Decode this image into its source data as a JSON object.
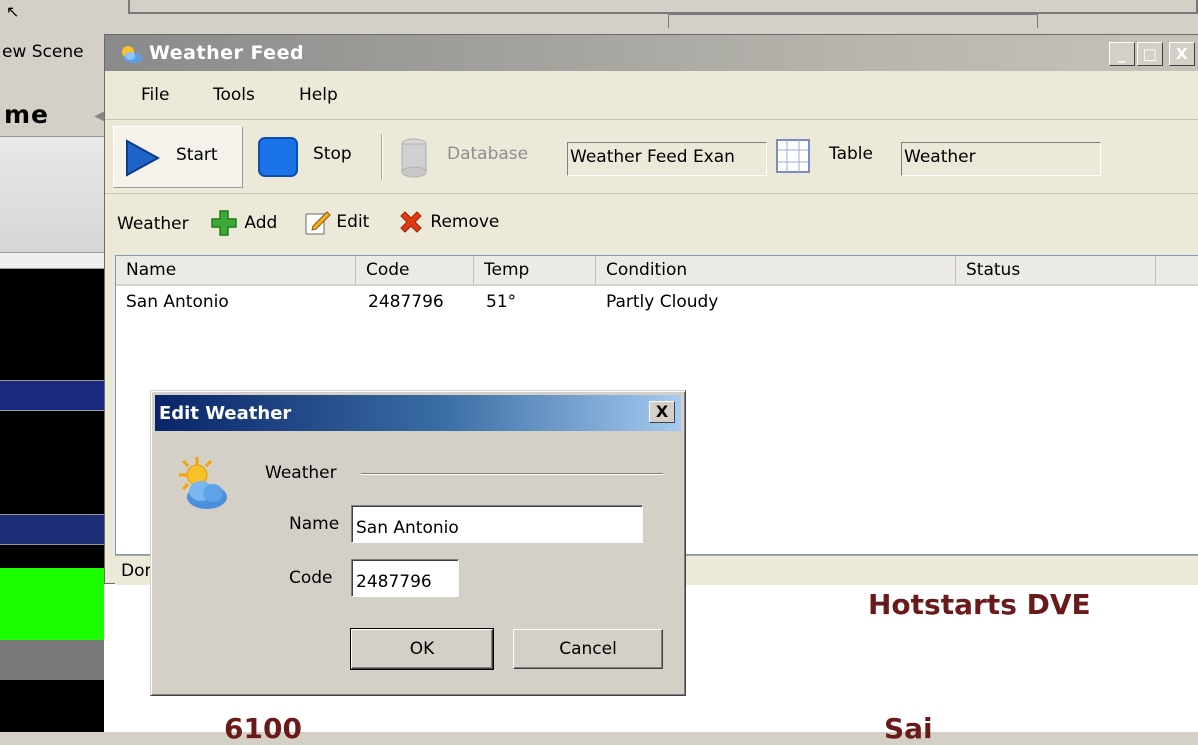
{
  "background": {
    "new_scene_label": "ew Scene",
    "name_header": "me",
    "hotstarts_text": "Hotstarts DVE",
    "cut_text_left": "6100",
    "cut_text_right": "Sai"
  },
  "window": {
    "title": "Weather Feed",
    "controls": {
      "minimize": "_",
      "maximize": "□",
      "close": "X"
    },
    "menu": [
      "File",
      "Tools",
      "Help"
    ],
    "toolbar": {
      "start_label": "Start",
      "stop_label": "Stop",
      "database_label": "Database",
      "database_value": "Weather Feed Exan",
      "table_label": "Table",
      "table_value": "Weather"
    },
    "subbar": {
      "weather_label": "Weather",
      "add_label": "Add",
      "edit_label": "Edit",
      "remove_label": "Remove"
    },
    "table": {
      "columns": [
        "Name",
        "Code",
        "Temp",
        "Condition",
        "Status"
      ],
      "rows": [
        {
          "name": "San Antonio",
          "code": "2487796",
          "temp": "51°",
          "condition": "Partly Cloudy",
          "status": ""
        }
      ]
    },
    "status_text": "Dor"
  },
  "dialog": {
    "title": "Edit Weather",
    "close": "X",
    "group_label": "Weather",
    "name_label": "Name",
    "name_value": "San Antonio",
    "code_label": "Code",
    "code_value": "2487796",
    "ok_label": "OK",
    "cancel_label": "Cancel"
  },
  "colors": {
    "dialog_title_start": "#0a246a",
    "dialog_title_end": "#a6caf0",
    "hotstarts_color": "#6a1a1a",
    "start_icon": "#1e64c8",
    "stop_icon": "#1a73e8",
    "add_icon": "#3aaa35",
    "remove_icon": "#e03a10"
  }
}
